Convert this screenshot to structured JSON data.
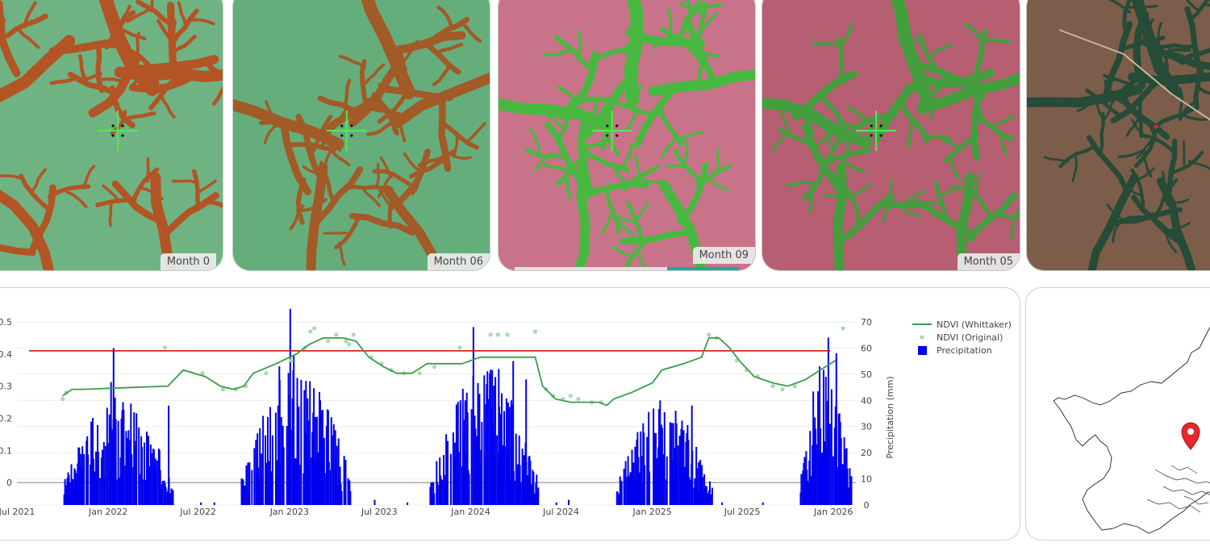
{
  "tiles": [
    {
      "label": "Month 0",
      "palette": "swir-a"
    },
    {
      "label": "Month 06",
      "palette": "swir-b"
    },
    {
      "label": "Month 09",
      "palette": "false-color-a",
      "progress": 0.32
    },
    {
      "label": "Month 05",
      "palette": "false-color-b"
    },
    {
      "label": "",
      "palette": "true-color"
    }
  ],
  "colors": {
    "whittaker": "#3a9d49",
    "original": "#a7dcae",
    "precip": "#0000ee",
    "threshold": "#cc0000",
    "marker": "#e8262c",
    "crosshair": "#56e856"
  },
  "map": {
    "marker_icon": "map-pin-icon"
  },
  "chart_data": {
    "type": "bar-line-combo",
    "x_range": [
      "2021-07-01",
      "2026-02-15"
    ],
    "x_ticks": [
      "Jul 2021",
      "Jan 2022",
      "Jul 2022",
      "Jan 2023",
      "Jul 2023",
      "Jan 2024",
      "Jul 2024",
      "Jan 2025",
      "Jul 2025",
      "Jan 2026"
    ],
    "y_left": {
      "range": [
        -0.07,
        0.5
      ],
      "ticks": [
        0,
        0.1,
        0.2,
        0.3,
        0.4,
        0.5
      ],
      "tick_labels": [
        "0",
        "0.1",
        "0.2",
        "0.3",
        "0.4",
        "0.5"
      ]
    },
    "y_right": {
      "label": "Precipitation (mm)",
      "range": [
        0,
        70
      ],
      "ticks": [
        0,
        10,
        20,
        30,
        40,
        50,
        60,
        70
      ]
    },
    "threshold": 0.41,
    "legend": {
      "position": "top-right",
      "items": [
        "NDVI (Whittaker)",
        "NDVI (Original)",
        "Precipitation"
      ]
    },
    "series": [
      {
        "name": "NDVI (Whittaker)",
        "type": "line",
        "points": [
          [
            "2021-10-01",
            0.27
          ],
          [
            "2021-10-20",
            0.29
          ],
          [
            "2021-11-10",
            0.29
          ],
          [
            "2022-05-01",
            0.3
          ],
          [
            "2022-06-01",
            0.35
          ],
          [
            "2022-07-15",
            0.33
          ],
          [
            "2022-08-15",
            0.3
          ],
          [
            "2022-09-10",
            0.29
          ],
          [
            "2022-10-01",
            0.3
          ],
          [
            "2022-10-20",
            0.34
          ],
          [
            "2022-12-05",
            0.37
          ],
          [
            "2023-01-15",
            0.4
          ],
          [
            "2023-02-10",
            0.43
          ],
          [
            "2023-03-10",
            0.45
          ],
          [
            "2023-04-20",
            0.45
          ],
          [
            "2023-05-15",
            0.44
          ],
          [
            "2023-06-10",
            0.39
          ],
          [
            "2023-07-10",
            0.36
          ],
          [
            "2023-08-05",
            0.34
          ],
          [
            "2023-09-05",
            0.34
          ],
          [
            "2023-10-05",
            0.37
          ],
          [
            "2023-11-15",
            0.37
          ],
          [
            "2023-12-15",
            0.37
          ],
          [
            "2024-01-20",
            0.39
          ],
          [
            "2024-03-20",
            0.39
          ],
          [
            "2024-05-10",
            0.39
          ],
          [
            "2024-05-25",
            0.3
          ],
          [
            "2024-06-20",
            0.26
          ],
          [
            "2024-07-20",
            0.25
          ],
          [
            "2024-09-15",
            0.25
          ],
          [
            "2024-10-01",
            0.24
          ],
          [
            "2024-10-15",
            0.26
          ],
          [
            "2024-11-20",
            0.28
          ],
          [
            "2025-01-01",
            0.31
          ],
          [
            "2025-01-20",
            0.35
          ],
          [
            "2025-03-05",
            0.37
          ],
          [
            "2025-04-10",
            0.39
          ],
          [
            "2025-04-25",
            0.45
          ],
          [
            "2025-05-15",
            0.45
          ],
          [
            "2025-06-05",
            0.42
          ],
          [
            "2025-06-25",
            0.38
          ],
          [
            "2025-07-25",
            0.33
          ],
          [
            "2025-09-01",
            0.31
          ],
          [
            "2025-10-01",
            0.3
          ],
          [
            "2025-11-05",
            0.32
          ],
          [
            "2025-12-05",
            0.35
          ],
          [
            "2026-01-05",
            0.38
          ]
        ]
      },
      {
        "name": "NDVI (Original)",
        "type": "scatter",
        "points": [
          [
            "2021-10-01",
            0.26
          ],
          [
            "2021-10-08",
            0.28
          ],
          [
            "2022-04-25",
            0.42
          ],
          [
            "2022-07-10",
            0.34
          ],
          [
            "2022-08-20",
            0.29
          ],
          [
            "2022-09-15",
            0.29
          ],
          [
            "2022-10-05",
            0.3
          ],
          [
            "2022-11-15",
            0.34
          ],
          [
            "2023-01-05",
            0.38
          ],
          [
            "2023-02-01",
            0.42
          ],
          [
            "2023-02-12",
            0.47
          ],
          [
            "2023-02-20",
            0.48
          ],
          [
            "2023-03-20",
            0.44
          ],
          [
            "2023-04-05",
            0.46
          ],
          [
            "2023-04-25",
            0.44
          ],
          [
            "2023-05-01",
            0.43
          ],
          [
            "2023-05-10",
            0.46
          ],
          [
            "2023-06-15",
            0.39
          ],
          [
            "2023-07-05",
            0.37
          ],
          [
            "2023-07-25",
            0.35
          ],
          [
            "2023-08-20",
            0.34
          ],
          [
            "2023-09-20",
            0.34
          ],
          [
            "2023-10-20",
            0.36
          ],
          [
            "2023-12-10",
            0.42
          ],
          [
            "2024-02-10",
            0.46
          ],
          [
            "2024-02-25",
            0.46
          ],
          [
            "2024-03-15",
            0.46
          ],
          [
            "2024-05-10",
            0.47
          ],
          [
            "2024-06-01",
            0.29
          ],
          [
            "2024-06-15",
            0.27
          ],
          [
            "2024-07-05",
            0.26
          ],
          [
            "2024-07-20",
            0.27
          ],
          [
            "2024-08-05",
            0.26
          ],
          [
            "2024-09-01",
            0.25
          ],
          [
            "2024-09-20",
            0.25
          ],
          [
            "2025-04-25",
            0.46
          ],
          [
            "2025-05-10",
            0.45
          ],
          [
            "2025-06-20",
            0.38
          ],
          [
            "2025-07-10",
            0.35
          ],
          [
            "2025-08-01",
            0.33
          ],
          [
            "2025-09-01",
            0.3
          ],
          [
            "2025-09-20",
            0.29
          ],
          [
            "2025-10-15",
            0.3
          ],
          [
            "2026-01-20",
            0.48
          ]
        ]
      },
      {
        "name": "Precipitation",
        "type": "bar",
        "axis": "right",
        "seasons": [
          {
            "start": "2021-10-01",
            "end": "2022-05-10",
            "peak": 38
          },
          {
            "start": "2022-09-25",
            "end": "2023-05-05",
            "peak": 48
          },
          {
            "start": "2023-10-10",
            "end": "2024-05-15",
            "peak": 48
          },
          {
            "start": "2024-10-20",
            "end": "2025-04-30",
            "peak": 37
          },
          {
            "start": "2025-10-25",
            "end": "2026-02-05",
            "peak": 52
          }
        ],
        "tallest": [
          [
            "2022-01-10",
            60
          ],
          [
            "2022-01-05",
            47
          ],
          [
            "2023-01-01",
            75
          ],
          [
            "2023-01-08",
            57
          ],
          [
            "2022-12-10",
            53
          ],
          [
            "2024-01-05",
            68
          ],
          [
            "2024-03-25",
            55
          ],
          [
            "2024-02-25",
            52
          ],
          [
            "2025-01-15",
            40
          ],
          [
            "2025-03-20",
            38
          ],
          [
            "2025-12-20",
            64
          ],
          [
            "2026-01-05",
            58
          ],
          [
            "2025-12-15",
            49
          ],
          [
            "2022-05-01",
            38
          ],
          [
            "2024-04-20",
            48
          ]
        ]
      }
    ]
  }
}
